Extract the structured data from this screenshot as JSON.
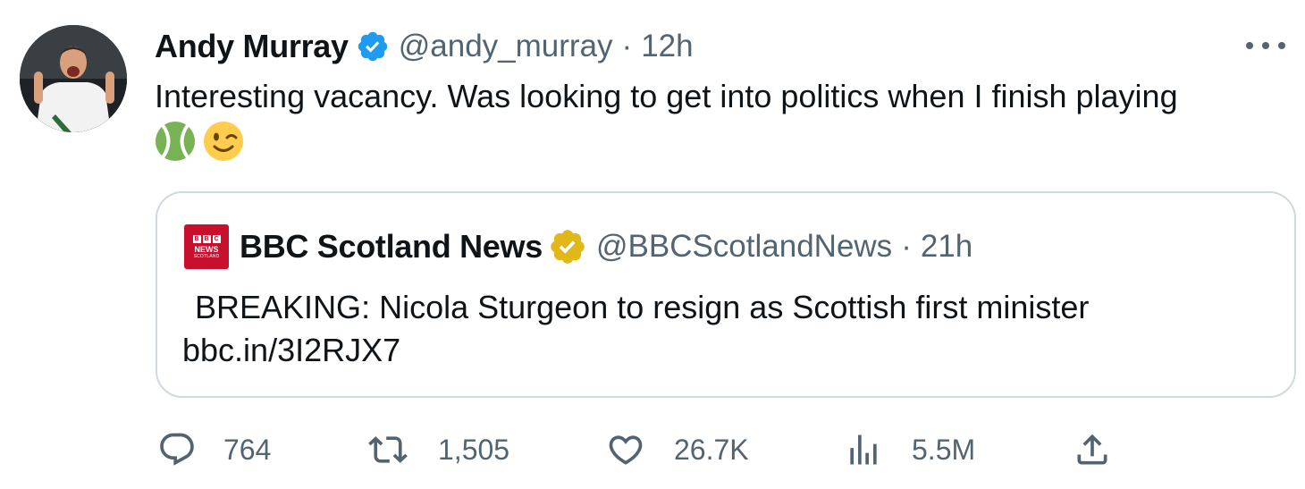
{
  "tweet": {
    "author_name": "Andy Murray",
    "handle": "@andy_murray",
    "time": "12h",
    "separator": "·",
    "text": "Interesting vacancy. Was looking to get into politics when I finish playing",
    "emojis": [
      "tennis-ball",
      "winking-face"
    ]
  },
  "quoted_tweet": {
    "logo_lines": [
      "BBC",
      "NEWS",
      "SCOTLAND"
    ],
    "author_name": "BBC Scotland News",
    "handle": "@BBCScotlandNews",
    "time": "21h",
    "separator": "·",
    "text": " BREAKING: Nicola Sturgeon to resign as Scottish first minister",
    "link": "bbc.in/3I2RJX7"
  },
  "actions": {
    "replies": "764",
    "reposts": "1,505",
    "likes": "26.7K",
    "views": "5.5M"
  },
  "colors": {
    "verified_blue": "#1d9bf0",
    "verified_gold": "#e2b719",
    "muted_text": "#536471",
    "border": "#cfd9de"
  },
  "icons": [
    "verified-badge-icon",
    "more-options-icon",
    "gold-verified-badge-icon",
    "reply-icon",
    "repost-icon",
    "like-icon",
    "views-icon",
    "share-icon"
  ]
}
